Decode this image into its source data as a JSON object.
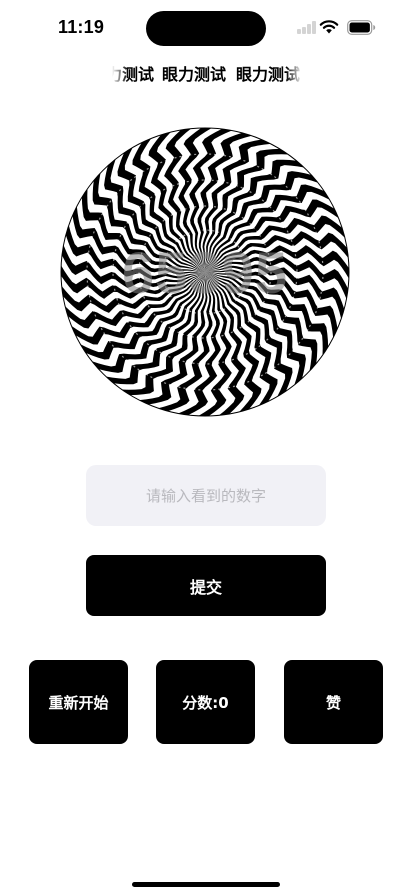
{
  "status_bar": {
    "time": "11:19",
    "signal_icon": "cellular-signal-icon",
    "wifi_icon": "wifi-icon",
    "battery_icon": "battery-icon"
  },
  "header": {
    "marquee_text": "眼力测试",
    "marquee_items": [
      "眼力测试",
      "眼力测试",
      "眼力测试"
    ]
  },
  "illusion": {
    "hidden_digits": "65395",
    "pattern": "radial-zigzag-black-white"
  },
  "answer_input": {
    "value": "",
    "placeholder": "请输入看到的数字"
  },
  "buttons": {
    "submit": "提交",
    "restart": "重新开始",
    "score": "分数:0",
    "like": "赞"
  },
  "colors": {
    "accent": "#000000",
    "input_background": "#f1f1f6",
    "placeholder": "#b9b9be"
  }
}
